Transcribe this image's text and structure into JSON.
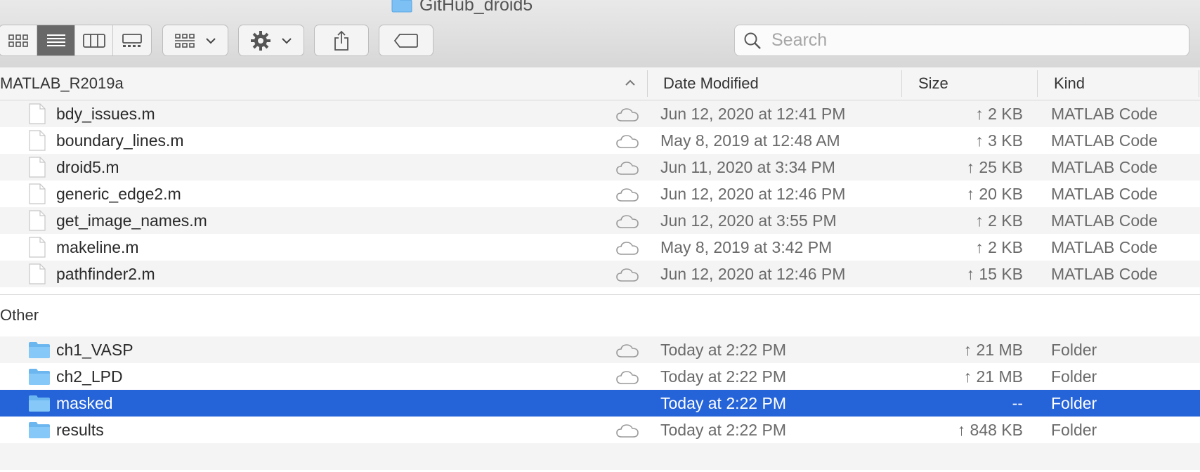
{
  "window": {
    "title": "GitHub_droid5"
  },
  "toolbar": {
    "view_modes": [
      {
        "name": "icon-view",
        "icon": "icon-grid-icon",
        "active": false
      },
      {
        "name": "list-view",
        "icon": "list-icon",
        "active": true
      },
      {
        "name": "column-view",
        "icon": "columns-icon",
        "active": false
      },
      {
        "name": "gallery-view",
        "icon": "gallery-icon",
        "active": false
      }
    ],
    "group_button": {
      "icon": "group-icon"
    },
    "action_button": {
      "icon": "gear-icon"
    },
    "share_button": {
      "icon": "share-icon"
    },
    "tag_button": {
      "icon": "tag-icon"
    },
    "search": {
      "placeholder": "Search",
      "value": ""
    }
  },
  "columns": {
    "name": "MATLAB_R2019a",
    "date": "Date Modified",
    "size": "Size",
    "kind": "Kind",
    "sort_indicator": "ascending"
  },
  "groups": [
    {
      "label": "",
      "items": [
        {
          "name": "bdy_issues.m",
          "date": "Jun 12, 2020 at 12:41 PM",
          "size": "↑ 2 KB",
          "kind": "MATLAB Code",
          "type": "file",
          "cloud": true
        },
        {
          "name": "boundary_lines.m",
          "date": "May 8, 2019 at 12:48 AM",
          "size": "↑ 3 KB",
          "kind": "MATLAB Code",
          "type": "file",
          "cloud": true
        },
        {
          "name": "droid5.m",
          "date": "Jun 11, 2020 at 3:34 PM",
          "size": "↑ 25 KB",
          "kind": "MATLAB Code",
          "type": "file",
          "cloud": true
        },
        {
          "name": "generic_edge2.m",
          "date": "Jun 12, 2020 at 12:46 PM",
          "size": "↑ 20 KB",
          "kind": "MATLAB Code",
          "type": "file",
          "cloud": true
        },
        {
          "name": "get_image_names.m",
          "date": "Jun 12, 2020 at 3:55 PM",
          "size": "↑ 2 KB",
          "kind": "MATLAB Code",
          "type": "file",
          "cloud": true
        },
        {
          "name": "makeline.m",
          "date": "May 8, 2019 at 3:42 PM",
          "size": "↑ 2 KB",
          "kind": "MATLAB Code",
          "type": "file",
          "cloud": true
        },
        {
          "name": "pathfinder2.m",
          "date": "Jun 12, 2020 at 12:46 PM",
          "size": "↑ 15 KB",
          "kind": "MATLAB Code",
          "type": "file",
          "cloud": true
        }
      ]
    },
    {
      "label": "Other",
      "items": [
        {
          "name": "ch1_VASP",
          "date": "Today at 2:22 PM",
          "size": "↑ 21 MB",
          "kind": "Folder",
          "type": "folder",
          "cloud": true
        },
        {
          "name": "ch2_LPD",
          "date": "Today at 2:22 PM",
          "size": "↑ 21 MB",
          "kind": "Folder",
          "type": "folder",
          "cloud": true
        },
        {
          "name": "masked",
          "date": "Today at 2:22 PM",
          "size": "--",
          "kind": "Folder",
          "type": "folder",
          "cloud": false,
          "selected": true
        },
        {
          "name": "results",
          "date": "Today at 2:22 PM",
          "size": "↑ 848 KB",
          "kind": "Folder",
          "type": "folder",
          "cloud": true
        }
      ]
    }
  ],
  "colors": {
    "selection": "#2563d9",
    "folder": "#6cb6f0",
    "toolbar": "#dedede"
  }
}
